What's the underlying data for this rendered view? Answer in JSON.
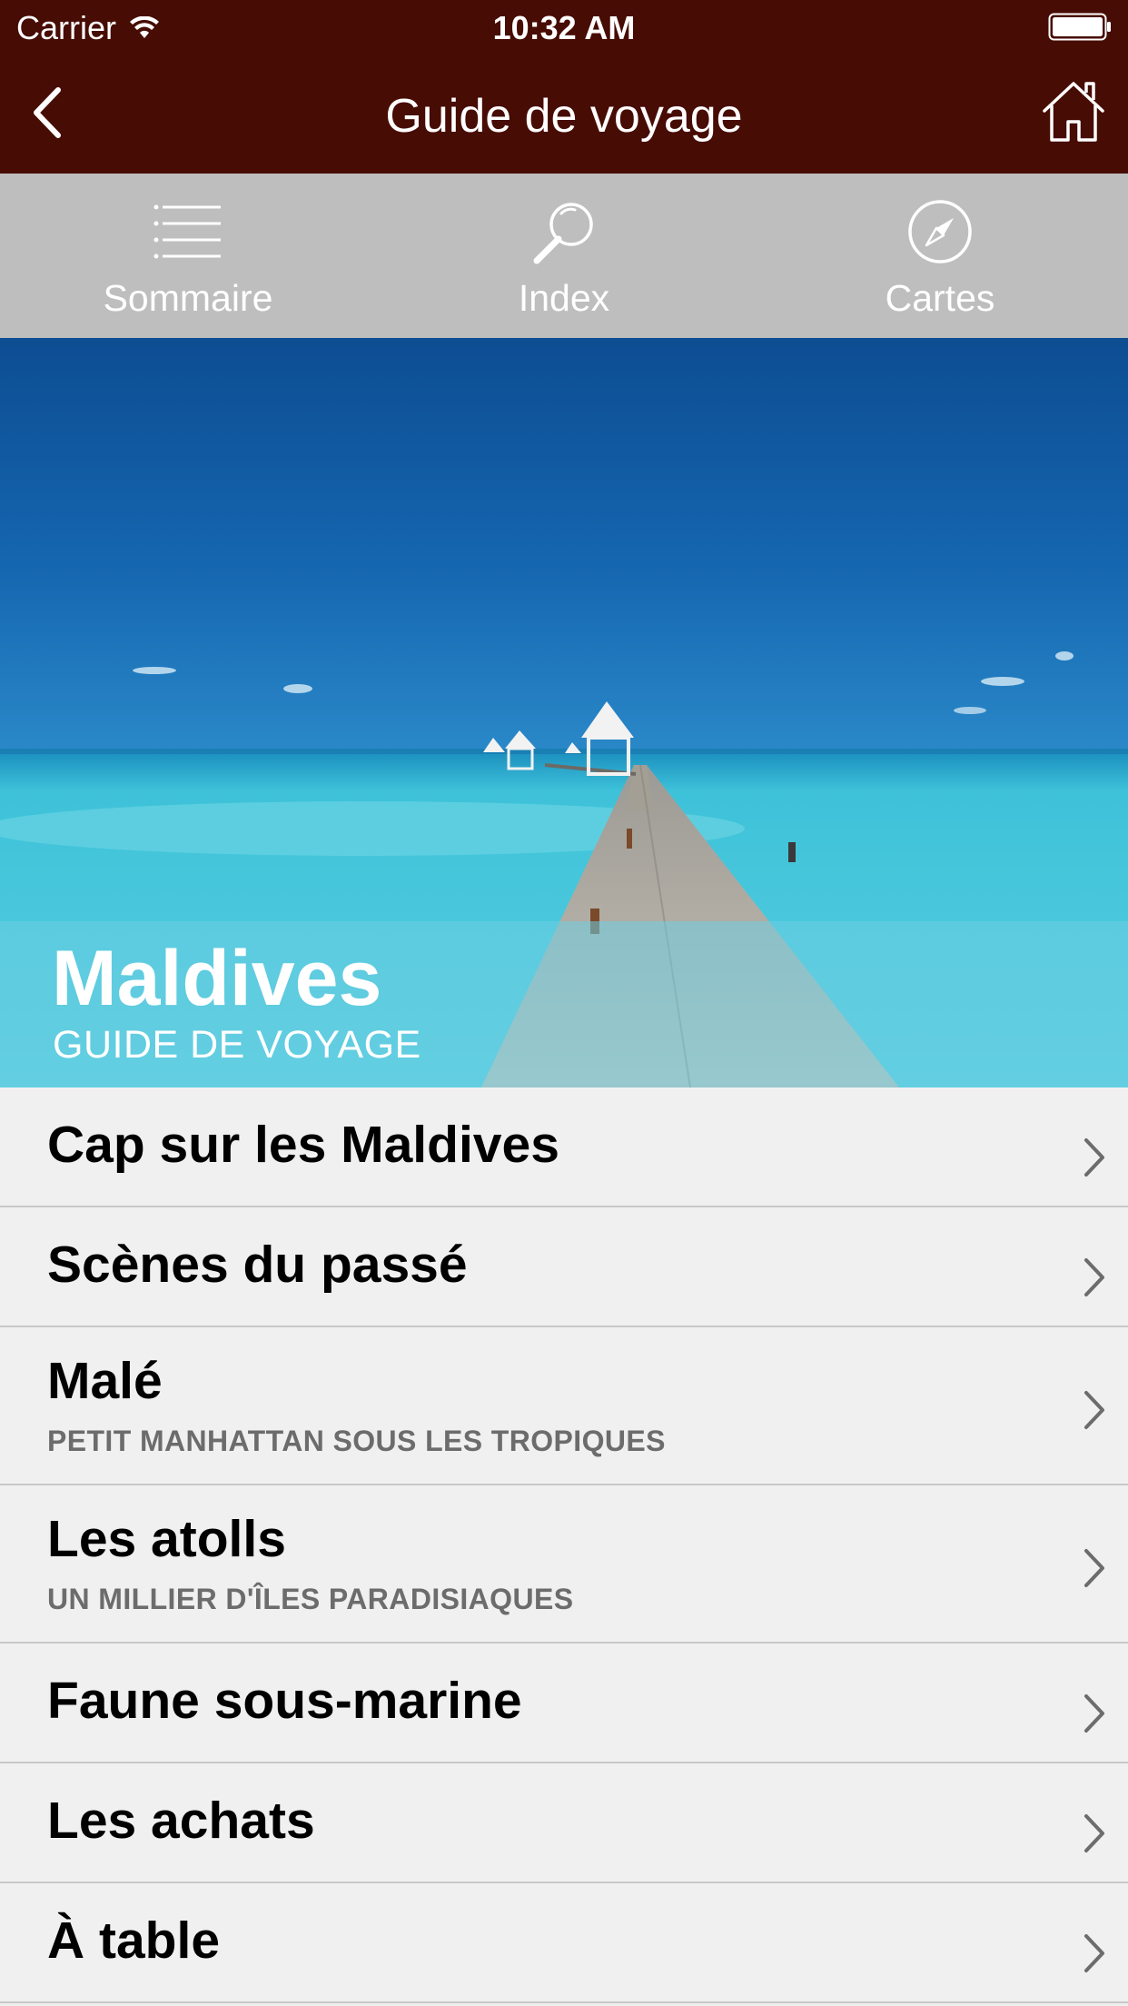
{
  "status": {
    "carrier": "Carrier",
    "time": "10:32 AM"
  },
  "nav": {
    "title": "Guide de voyage",
    "back_icon": "chevron-left-icon",
    "home_icon": "home-icon"
  },
  "tabs": [
    {
      "label": "Sommaire",
      "icon": "list-icon"
    },
    {
      "label": "Index",
      "icon": "search-icon"
    },
    {
      "label": "Cartes",
      "icon": "compass-icon"
    }
  ],
  "hero": {
    "title": "Maldives",
    "subtitle": "GUIDE DE VOYAGE"
  },
  "sections": [
    {
      "title": "Cap sur les Maldives",
      "subtitle": ""
    },
    {
      "title": "Scènes du passé",
      "subtitle": ""
    },
    {
      "title": "Malé",
      "subtitle": "PETIT MANHATTAN SOUS LES TROPIQUES"
    },
    {
      "title": "Les atolls",
      "subtitle": "UN MILLIER D'ÎLES PARADISIAQUES"
    },
    {
      "title": "Faune sous-marine",
      "subtitle": ""
    },
    {
      "title": "Les achats",
      "subtitle": ""
    },
    {
      "title": "À table",
      "subtitle": ""
    }
  ],
  "colors": {
    "navbar": "#470c03",
    "tabbar": "#bebebe",
    "list_bg": "#f0f0f0",
    "subtitle": "#6c6c6c"
  }
}
